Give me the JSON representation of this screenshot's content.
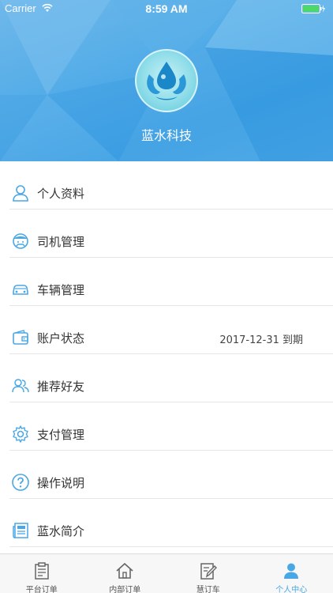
{
  "status_bar": {
    "carrier": "Carrier",
    "time": "8:59 AM"
  },
  "profile": {
    "company_name": "蓝水科技"
  },
  "menu": {
    "items": [
      {
        "label": "个人资料",
        "icon": "user-icon"
      },
      {
        "label": "司机管理",
        "icon": "driver-icon"
      },
      {
        "label": "车辆管理",
        "icon": "car-icon"
      },
      {
        "label": "账户状态",
        "icon": "wallet-icon",
        "value": "2017-12-31 到期"
      },
      {
        "label": "推荐好友",
        "icon": "friends-icon"
      },
      {
        "label": "支付管理",
        "icon": "gear-icon"
      },
      {
        "label": "操作说明",
        "icon": "help-icon"
      },
      {
        "label": "蓝水简介",
        "icon": "newspaper-icon"
      }
    ]
  },
  "tabbar": {
    "tabs": [
      {
        "label": "平台订单",
        "icon": "clipboard-icon",
        "active": false
      },
      {
        "label": "内部订单",
        "icon": "home-icon",
        "active": false
      },
      {
        "label": "慧订车",
        "icon": "edit-document-icon",
        "active": false
      },
      {
        "label": "个人中心",
        "icon": "person-icon",
        "active": true
      }
    ]
  },
  "colors": {
    "accent": "#4aa7e6",
    "header_blue": "#57aee8",
    "battery_green": "#4cd964"
  }
}
